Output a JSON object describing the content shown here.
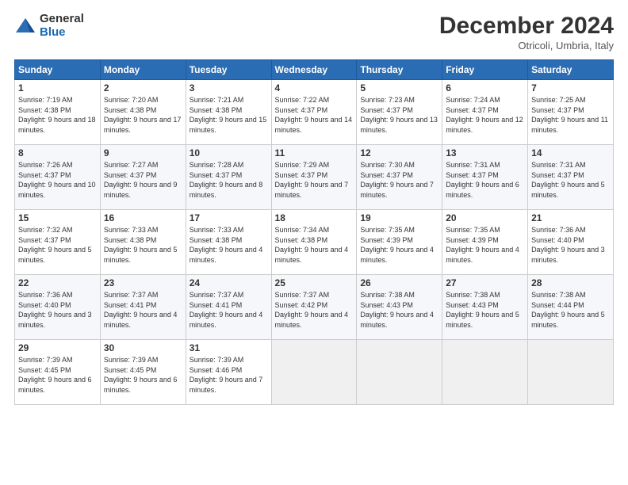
{
  "header": {
    "logo_general": "General",
    "logo_blue": "Blue",
    "month_title": "December 2024",
    "location": "Otricoli, Umbria, Italy"
  },
  "days_of_week": [
    "Sunday",
    "Monday",
    "Tuesday",
    "Wednesday",
    "Thursday",
    "Friday",
    "Saturday"
  ],
  "weeks": [
    [
      {
        "day": "1",
        "sunrise": "7:19 AM",
        "sunset": "4:38 PM",
        "daylight": "9 hours and 18 minutes."
      },
      {
        "day": "2",
        "sunrise": "7:20 AM",
        "sunset": "4:38 PM",
        "daylight": "9 hours and 17 minutes."
      },
      {
        "day": "3",
        "sunrise": "7:21 AM",
        "sunset": "4:38 PM",
        "daylight": "9 hours and 15 minutes."
      },
      {
        "day": "4",
        "sunrise": "7:22 AM",
        "sunset": "4:37 PM",
        "daylight": "9 hours and 14 minutes."
      },
      {
        "day": "5",
        "sunrise": "7:23 AM",
        "sunset": "4:37 PM",
        "daylight": "9 hours and 13 minutes."
      },
      {
        "day": "6",
        "sunrise": "7:24 AM",
        "sunset": "4:37 PM",
        "daylight": "9 hours and 12 minutes."
      },
      {
        "day": "7",
        "sunrise": "7:25 AM",
        "sunset": "4:37 PM",
        "daylight": "9 hours and 11 minutes."
      }
    ],
    [
      {
        "day": "8",
        "sunrise": "7:26 AM",
        "sunset": "4:37 PM",
        "daylight": "9 hours and 10 minutes."
      },
      {
        "day": "9",
        "sunrise": "7:27 AM",
        "sunset": "4:37 PM",
        "daylight": "9 hours and 9 minutes."
      },
      {
        "day": "10",
        "sunrise": "7:28 AM",
        "sunset": "4:37 PM",
        "daylight": "9 hours and 8 minutes."
      },
      {
        "day": "11",
        "sunrise": "7:29 AM",
        "sunset": "4:37 PM",
        "daylight": "9 hours and 7 minutes."
      },
      {
        "day": "12",
        "sunrise": "7:30 AM",
        "sunset": "4:37 PM",
        "daylight": "9 hours and 7 minutes."
      },
      {
        "day": "13",
        "sunrise": "7:31 AM",
        "sunset": "4:37 PM",
        "daylight": "9 hours and 6 minutes."
      },
      {
        "day": "14",
        "sunrise": "7:31 AM",
        "sunset": "4:37 PM",
        "daylight": "9 hours and 5 minutes."
      }
    ],
    [
      {
        "day": "15",
        "sunrise": "7:32 AM",
        "sunset": "4:37 PM",
        "daylight": "9 hours and 5 minutes."
      },
      {
        "day": "16",
        "sunrise": "7:33 AM",
        "sunset": "4:38 PM",
        "daylight": "9 hours and 5 minutes."
      },
      {
        "day": "17",
        "sunrise": "7:33 AM",
        "sunset": "4:38 PM",
        "daylight": "9 hours and 4 minutes."
      },
      {
        "day": "18",
        "sunrise": "7:34 AM",
        "sunset": "4:38 PM",
        "daylight": "9 hours and 4 minutes."
      },
      {
        "day": "19",
        "sunrise": "7:35 AM",
        "sunset": "4:39 PM",
        "daylight": "9 hours and 4 minutes."
      },
      {
        "day": "20",
        "sunrise": "7:35 AM",
        "sunset": "4:39 PM",
        "daylight": "9 hours and 4 minutes."
      },
      {
        "day": "21",
        "sunrise": "7:36 AM",
        "sunset": "4:40 PM",
        "daylight": "9 hours and 3 minutes."
      }
    ],
    [
      {
        "day": "22",
        "sunrise": "7:36 AM",
        "sunset": "4:40 PM",
        "daylight": "9 hours and 3 minutes."
      },
      {
        "day": "23",
        "sunrise": "7:37 AM",
        "sunset": "4:41 PM",
        "daylight": "9 hours and 4 minutes."
      },
      {
        "day": "24",
        "sunrise": "7:37 AM",
        "sunset": "4:41 PM",
        "daylight": "9 hours and 4 minutes."
      },
      {
        "day": "25",
        "sunrise": "7:37 AM",
        "sunset": "4:42 PM",
        "daylight": "9 hours and 4 minutes."
      },
      {
        "day": "26",
        "sunrise": "7:38 AM",
        "sunset": "4:43 PM",
        "daylight": "9 hours and 4 minutes."
      },
      {
        "day": "27",
        "sunrise": "7:38 AM",
        "sunset": "4:43 PM",
        "daylight": "9 hours and 5 minutes."
      },
      {
        "day": "28",
        "sunrise": "7:38 AM",
        "sunset": "4:44 PM",
        "daylight": "9 hours and 5 minutes."
      }
    ],
    [
      {
        "day": "29",
        "sunrise": "7:39 AM",
        "sunset": "4:45 PM",
        "daylight": "9 hours and 6 minutes."
      },
      {
        "day": "30",
        "sunrise": "7:39 AM",
        "sunset": "4:45 PM",
        "daylight": "9 hours and 6 minutes."
      },
      {
        "day": "31",
        "sunrise": "7:39 AM",
        "sunset": "4:46 PM",
        "daylight": "9 hours and 7 minutes."
      },
      null,
      null,
      null,
      null
    ]
  ]
}
